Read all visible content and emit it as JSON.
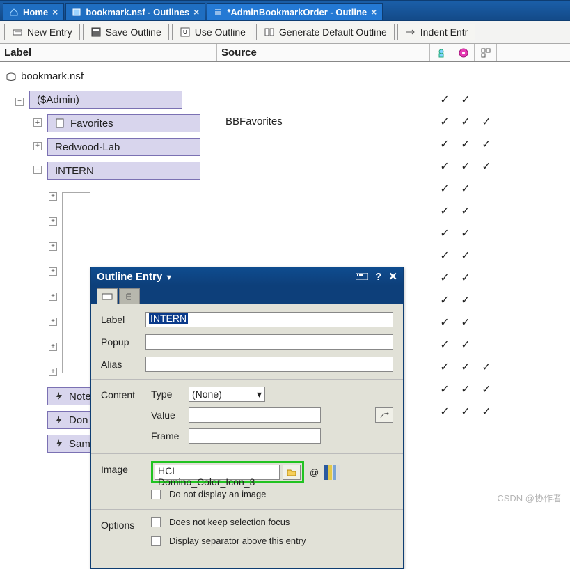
{
  "tabs": [
    {
      "label": "Home",
      "icon": "home"
    },
    {
      "label": "bookmark.nsf - Outlines",
      "icon": "db"
    },
    {
      "label": "*AdminBookmarkOrder - Outline",
      "icon": "outline"
    }
  ],
  "toolbar": {
    "new": "New Entry",
    "save": "Save Outline",
    "use": "Use Outline",
    "gen": "Generate Default Outline",
    "indent": "Indent Entr"
  },
  "columns": {
    "label": "Label",
    "source": "Source"
  },
  "root": "bookmark.nsf",
  "nodes": {
    "admin": "($Admin)",
    "fav": "Favorites",
    "fav_src": "BBFavorites",
    "redwood": "Redwood-Lab",
    "intern": "INTERN",
    "note": "Note",
    "don": "Don",
    "sam": "Sam"
  },
  "checks": [
    [
      true,
      true,
      false
    ],
    [
      true,
      true,
      true
    ],
    [
      true,
      true,
      true
    ],
    [
      true,
      true,
      true
    ],
    [
      true,
      true,
      false
    ],
    [
      true,
      true,
      false
    ],
    [
      true,
      true,
      false
    ],
    [
      true,
      true,
      false
    ],
    [
      true,
      true,
      false
    ],
    [
      true,
      true,
      false
    ],
    [
      true,
      true,
      false
    ],
    [
      true,
      true,
      false
    ],
    [
      true,
      true,
      true
    ],
    [
      true,
      true,
      true
    ],
    [
      true,
      true,
      true
    ]
  ],
  "dialog": {
    "title": "Outline Entry",
    "fields": {
      "label_lbl": "Label",
      "label_val": "INTERN",
      "popup_lbl": "Popup",
      "popup_val": "",
      "alias_lbl": "Alias",
      "alias_val": ""
    },
    "content": {
      "group": "Content",
      "type_lbl": "Type",
      "type_val": "(None)",
      "value_lbl": "Value",
      "value_val": "",
      "frame_lbl": "Frame",
      "frame_val": ""
    },
    "image": {
      "group": "Image",
      "val": "HCL Domino_Color_Icon_3",
      "at": "@",
      "cb": "Do not display an image"
    },
    "options": {
      "group": "Options",
      "cb1": "Does not keep selection focus",
      "cb2": "Display separator above this entry"
    }
  },
  "watermark": "CSDN @协作者"
}
